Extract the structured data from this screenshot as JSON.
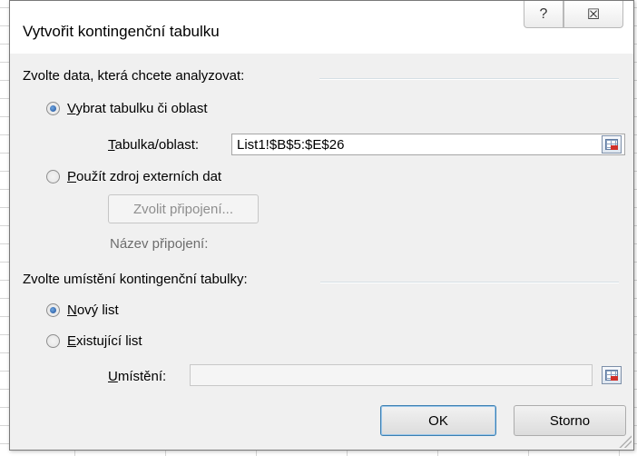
{
  "dialog": {
    "title": "Vytvořit kontingenční tabulku",
    "help_glyph": "?",
    "close_glyph": "☒"
  },
  "data_section": {
    "label": "Zvolte data, která chcete analyzovat:",
    "option_table": {
      "key": "V",
      "rest": "ybrat tabulku či oblast",
      "checked": true
    },
    "table_range_label_key": "T",
    "table_range_label_rest": "abulka/oblast:",
    "table_range_value": "List1!$B$5:$E$26",
    "option_external": {
      "key": "P",
      "rest": "oužít zdroj externích dat",
      "checked": false
    },
    "choose_connection_button": "Zvolit připojení...",
    "connection_name_label": "Název připojení:"
  },
  "location_section": {
    "label": "Zvolte umístění kontingenční tabulky:",
    "option_new": {
      "key": "N",
      "rest": "ový list",
      "checked": true
    },
    "option_existing": {
      "key": "E",
      "rest": "xistující list",
      "checked": false
    },
    "location_label_key": "U",
    "location_label_rest": "místění:",
    "location_value": ""
  },
  "buttons": {
    "ok": "OK",
    "cancel": "Storno"
  },
  "icons": {
    "help": "help-icon",
    "close": "close-icon",
    "range_picker": "range-picker-icon"
  }
}
